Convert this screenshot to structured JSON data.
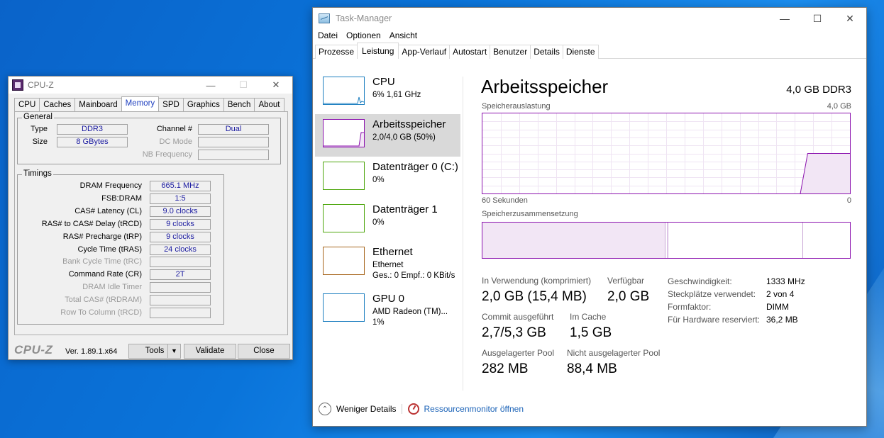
{
  "cpuz": {
    "title": "CPU-Z",
    "tabs": [
      "CPU",
      "Caches",
      "Mainboard",
      "Memory",
      "SPD",
      "Graphics",
      "Bench",
      "About"
    ],
    "active_tab": "Memory",
    "general": {
      "legend": "General",
      "type_label": "Type",
      "type_value": "DDR3",
      "size_label": "Size",
      "size_value": "8 GBytes",
      "channel_label": "Channel #",
      "channel_value": "Dual",
      "dc_mode_label": "DC Mode",
      "dc_mode_value": "",
      "nb_freq_label": "NB Frequency",
      "nb_freq_value": ""
    },
    "timings": {
      "legend": "Timings",
      "rows": [
        {
          "label": "DRAM Frequency",
          "value": "665.1 MHz",
          "enabled": true
        },
        {
          "label": "FSB:DRAM",
          "value": "1:5",
          "enabled": true
        },
        {
          "label": "CAS# Latency (CL)",
          "value": "9.0 clocks",
          "enabled": true
        },
        {
          "label": "RAS# to CAS# Delay (tRCD)",
          "value": "9 clocks",
          "enabled": true
        },
        {
          "label": "RAS# Precharge (tRP)",
          "value": "9 clocks",
          "enabled": true
        },
        {
          "label": "Cycle Time (tRAS)",
          "value": "24 clocks",
          "enabled": true
        },
        {
          "label": "Bank Cycle Time (tRC)",
          "value": "",
          "enabled": false
        },
        {
          "label": "Command Rate (CR)",
          "value": "2T",
          "enabled": true
        },
        {
          "label": "DRAM Idle Timer",
          "value": "",
          "enabled": false
        },
        {
          "label": "Total CAS# (tRDRAM)",
          "value": "",
          "enabled": false
        },
        {
          "label": "Row To Column (tRCD)",
          "value": "",
          "enabled": false
        }
      ]
    },
    "footer": {
      "brand": "CPU-Z",
      "version": "Ver. 1.89.1.x64",
      "tools": "Tools",
      "validate": "Validate",
      "close": "Close"
    }
  },
  "taskmanager": {
    "title": "Task-Manager",
    "menu": [
      "Datei",
      "Optionen",
      "Ansicht"
    ],
    "tabs": [
      "Prozesse",
      "Leistung",
      "App-Verlauf",
      "Autostart",
      "Benutzer",
      "Details",
      "Dienste"
    ],
    "active_tab": "Leistung",
    "sidebar": [
      {
        "name": "CPU",
        "sub1": "6%  1,61 GHz",
        "sub2": "",
        "color": "#1e7fc0"
      },
      {
        "name": "Arbeitsspeicher",
        "sub1": "2,0/4,0 GB (50%)",
        "sub2": "",
        "color": "#8b12ae"
      },
      {
        "name": "Datenträger 0 (C:)",
        "sub1": "0%",
        "sub2": "",
        "color": "#4da60c"
      },
      {
        "name": "Datenträger 1",
        "sub1": "0%",
        "sub2": "",
        "color": "#4da60c"
      },
      {
        "name": "Ethernet",
        "sub1": "Ethernet",
        "sub2": "Ges.: 0  Empf.: 0 KBit/s",
        "color": "#a7651c"
      },
      {
        "name": "GPU 0",
        "sub1": "AMD Radeon (TM)...",
        "sub2": "1%",
        "color": "#1e7fc0"
      }
    ],
    "main": {
      "title": "Arbeitsspeicher",
      "spec": "4,0 GB DDR3",
      "usage_label": "Speicherauslastung",
      "usage_max": "4,0 GB",
      "time_left": "60 Sekunden",
      "time_right": "0",
      "composition_label": "Speicherzusammensetzung",
      "usage_fraction_now": 0.5,
      "stats": {
        "in_use_label": "In Verwendung (komprimiert)",
        "in_use_value": "2,0 GB (15,4 MB)",
        "available_label": "Verfügbar",
        "available_value": "2,0 GB",
        "commit_label": "Commit ausgeführt",
        "commit_value": "2,7/5,3 GB",
        "cached_label": "Im Cache",
        "cached_value": "1,5 GB",
        "paged_label": "Ausgelagerter Pool",
        "paged_value": "282 MB",
        "nonpaged_label": "Nicht ausgelagerter Pool",
        "nonpaged_value": "88,4 MB"
      },
      "details": [
        {
          "key": "Geschwindigkeit:",
          "value": "1333 MHz"
        },
        {
          "key": "Steckplätze verwendet:",
          "value": "2 von 4"
        },
        {
          "key": "Formfaktor:",
          "value": "DIMM"
        },
        {
          "key": "Für Hardware reserviert:",
          "value": "36,2 MB"
        }
      ]
    },
    "footer": {
      "less_details": "Weniger Details",
      "resmon": "Ressourcenmonitor öffnen"
    }
  }
}
